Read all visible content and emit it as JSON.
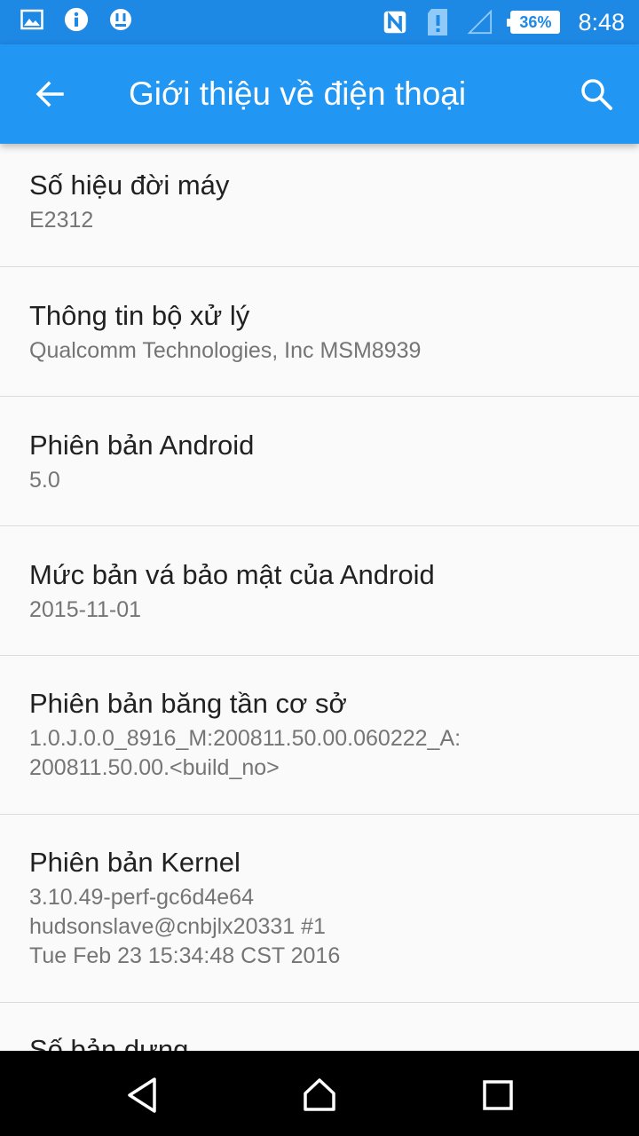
{
  "status_bar": {
    "time": "8:48",
    "battery": "36%",
    "left_icons": [
      "image-icon",
      "info-icon",
      "alert-face-icon"
    ],
    "right_icons": [
      "nfc-icon",
      "sim-alert-icon",
      "signal-icon"
    ],
    "color": "#1e88e5"
  },
  "app_bar": {
    "title": "Giới thiệu về điện thoại",
    "color": "#2196f3"
  },
  "items": [
    {
      "title": "Số hiệu đời máy",
      "value": "E2312"
    },
    {
      "title": "Thông tin bộ xử lý",
      "value": "Qualcomm Technologies, Inc MSM8939"
    },
    {
      "title": "Phiên bản Android",
      "value": "5.0"
    },
    {
      "title": "Mức bản vá bảo mật của Android",
      "value": "2015-11-01"
    },
    {
      "title": "Phiên bản băng tần cơ sở",
      "value": "1.0.J.0.0_8916_M:200811.50.00.060222_A:\n200811.50.00.<build_no>"
    },
    {
      "title": "Phiên bản Kernel",
      "value": "3.10.49-perf-gc6d4e64\nhudsonslave@cnbjlx20331 #1\nTue Feb 23 15:34:48 CST 2016"
    },
    {
      "title": "Số bản dựng",
      "value": ""
    }
  ]
}
